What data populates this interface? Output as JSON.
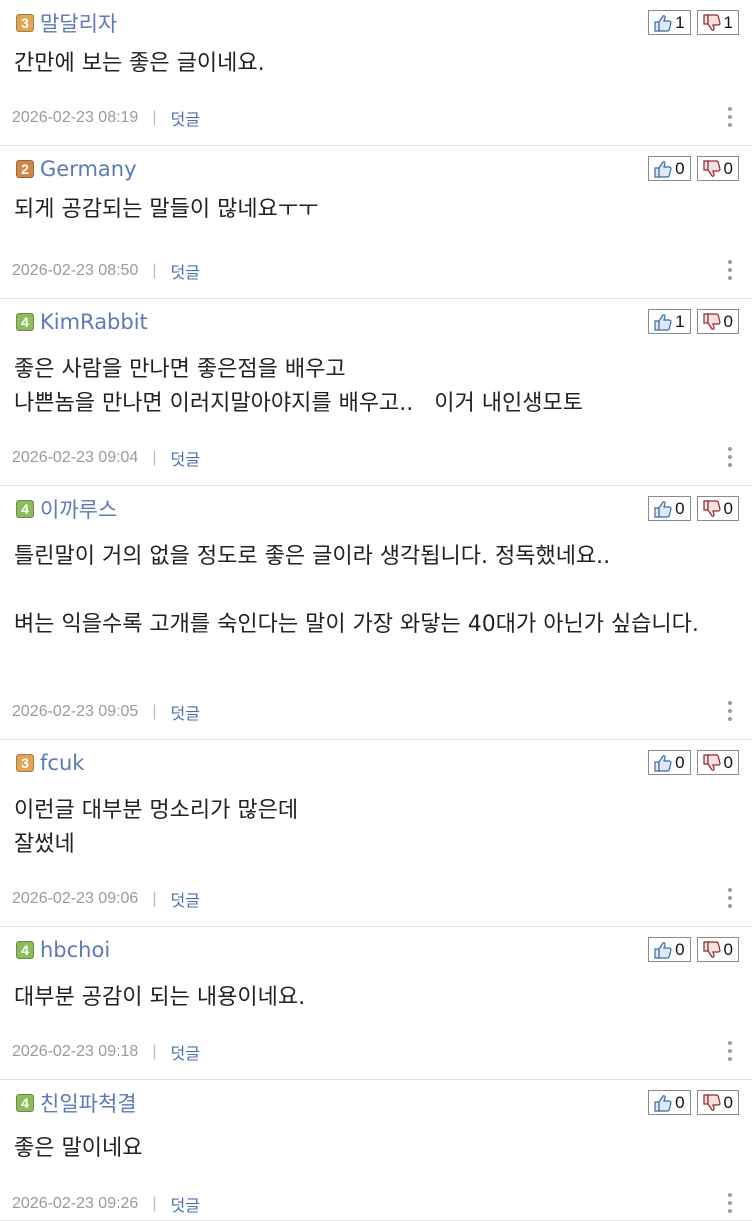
{
  "reply_label": "덧글",
  "colors": {
    "level_3": "#e1a556",
    "level_2": "#d2874a",
    "level_4": "#8cbc5b",
    "name": "#5c7ab8"
  },
  "comments": [
    {
      "level": "3",
      "name": "말달리자",
      "up": "1",
      "down": "1",
      "text": "간만에 보는 좋은 글이네요.",
      "date": "2026-02-23 08:19"
    },
    {
      "level": "2",
      "name": "Germany",
      "up": "0",
      "down": "0",
      "text": "되게 공감되는 말들이 많네요ㅜㅜ",
      "date": "2026-02-23 08:50"
    },
    {
      "level": "4",
      "name": "KimRabbit",
      "up": "1",
      "down": "0",
      "text": "좋은 사람을 만나면 좋은점을 배우고\n나쁜놈을 만나면 이러지말아야지를 배우고..   이거 내인생모토",
      "date": "2026-02-23 09:04"
    },
    {
      "level": "4",
      "name": "이까루스",
      "up": "0",
      "down": "0",
      "text": "틀린말이 거의 없을 정도로 좋은 글이라 생각됩니다. 정독했네요..\n\n벼는 익을수록 고개를 숙인다는 말이 가장 와닿는 40대가 아닌가 싶습니다.",
      "date": "2026-02-23 09:05"
    },
    {
      "level": "3",
      "name": "fcuk",
      "up": "0",
      "down": "0",
      "text": "이런글 대부분 멍소리가 많은데\n잘썼네",
      "date": "2026-02-23 09:06"
    },
    {
      "level": "4",
      "name": "hbchoi",
      "up": "0",
      "down": "0",
      "text": "대부분 공감이 되는 내용이네요.",
      "date": "2026-02-23 09:18"
    },
    {
      "level": "4",
      "name": "친일파척결",
      "up": "0",
      "down": "0",
      "text": "좋은 말이네요",
      "date": "2026-02-23 09:26"
    }
  ]
}
